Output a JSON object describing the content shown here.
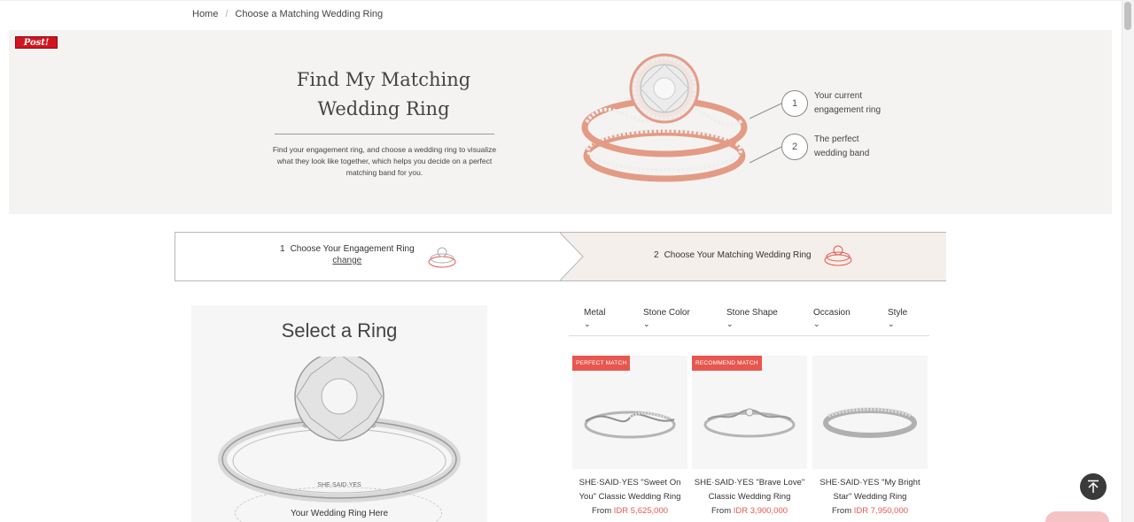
{
  "breadcrumb": {
    "home": "Home",
    "separator": "/",
    "current": "Choose a Matching Wedding Ring"
  },
  "hero": {
    "badge": "Post!",
    "title_line1": "Find My Matching",
    "title_line2": "Wedding Ring",
    "description": "Find your engagement ring, and choose a wedding ring to visualize what they look like together, which helps you decide on a perfect matching band for you.",
    "callouts": [
      {
        "num": "1",
        "line1": "Your current",
        "line2": "engagement ring"
      },
      {
        "num": "2",
        "line1": "The perfect",
        "line2": "wedding band"
      }
    ]
  },
  "steps": {
    "step1": {
      "num": "1",
      "label": "Choose Your Engagement Ring",
      "change": "change"
    },
    "step2": {
      "num": "2",
      "label": "Choose Your Matching Wedding Ring"
    }
  },
  "select_panel": {
    "title": "Select a Ring",
    "placeholder": "Your Wedding Ring Here"
  },
  "filters": [
    "Metal",
    "Stone Color",
    "Stone Shape",
    "Occasion",
    "Style"
  ],
  "products": [
    {
      "tag": "PERFECT MATCH",
      "name_line1": "SHE·SAID·YES \"Sweet On",
      "name_line2": "You\" Classic Wedding Ring",
      "from": "From",
      "price": "IDR 5,625,000"
    },
    {
      "tag": "RECOMMEND MATCH",
      "name_line1": "SHE·SAID·YES \"Brave Love\"",
      "name_line2": "Classic Wedding Ring",
      "from": "From",
      "price": "IDR 3,900,000"
    },
    {
      "tag": "",
      "name_line1": "SHE·SAID·YES \"My Bright",
      "name_line2": "Star\" Wedding Ring",
      "from": "From",
      "price": "IDR 7,950,000"
    }
  ],
  "colors": {
    "accent": "#e8574f",
    "rose_gold": "#e39b86",
    "hero_bg": "#f5f3f1",
    "step_active_bg": "#f4efeb"
  }
}
